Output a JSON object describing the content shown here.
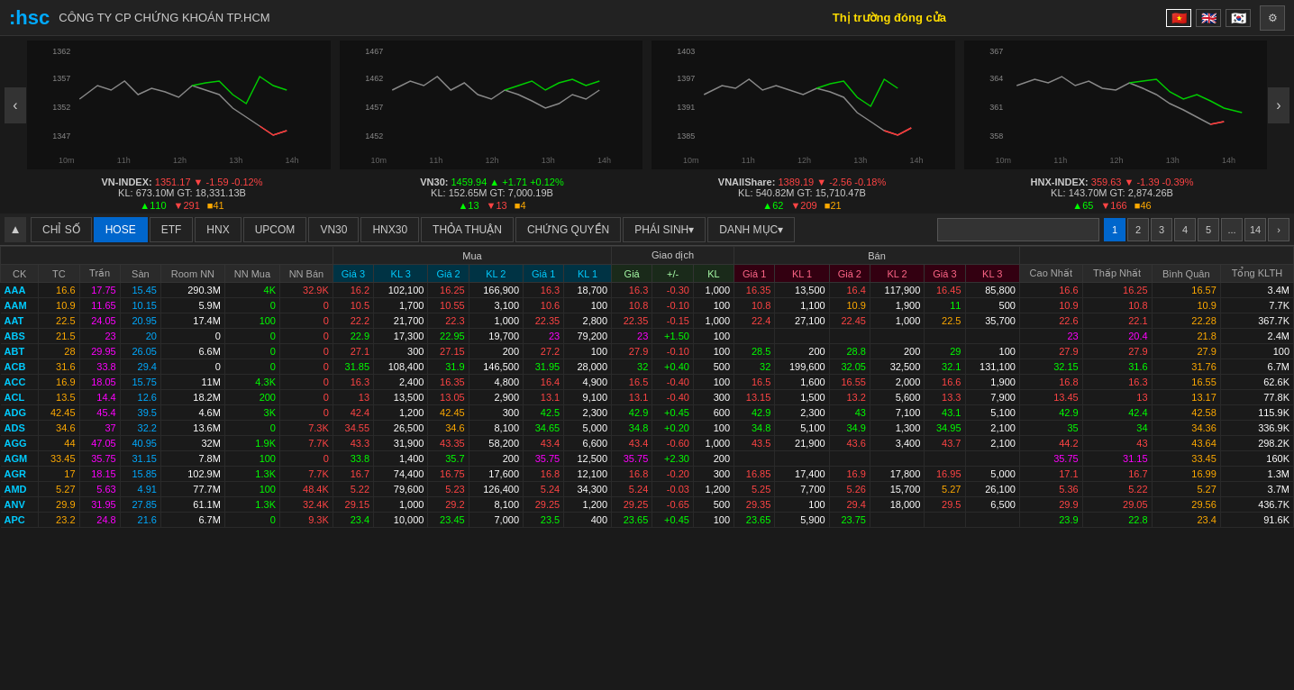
{
  "header": {
    "logo": ":hsc",
    "company": "CÔNG TY CP CHỨNG KHOÁN TP.HCM",
    "market_status": "Thị trường đóng cửa",
    "flags": [
      "🇻🇳",
      "🇬🇧",
      "🇰🇷"
    ],
    "gear_icon": "⚙"
  },
  "indices": [
    {
      "name": "VN-INDEX",
      "value": "1351.17",
      "arrow": "▼",
      "change": "-1.59",
      "pct": "-0.12%",
      "kl": "673.10M",
      "gt": "18,331.13B",
      "up": "110",
      "down": "291",
      "same": "41"
    },
    {
      "name": "VN30",
      "value": "1459.94",
      "arrow": "▲",
      "change": "+1.71",
      "pct": "+0.12%",
      "kl": "152.65M",
      "gt": "7,000.19B",
      "up": "13",
      "down": "13",
      "same": "4"
    },
    {
      "name": "VNAllShare",
      "value": "1389.19",
      "arrow": "▼",
      "change": "-2.56",
      "pct": "-0.18%",
      "kl": "540.82M",
      "gt": "15,710.47B",
      "up": "62",
      "down": "209",
      "same": "21"
    },
    {
      "name": "HNX-INDEX",
      "value": "359.63",
      "arrow": "▼",
      "change": "-1.39",
      "pct": "-0.39%",
      "kl": "143.70M",
      "gt": "2,874.26B",
      "up": "65",
      "down": "166",
      "same": "46"
    }
  ],
  "tabs": {
    "nav": [
      "CHỈ SỐ",
      "HOSE",
      "ETF",
      "HNX",
      "UPCOM",
      "VN30",
      "HNX30",
      "THỎA THUẬN",
      "CHỨNG QUYỀN",
      "PHÁI SINH",
      "DANH MỤC"
    ],
    "active": "HOSE",
    "pages": [
      "1",
      "2",
      "3",
      "4",
      "5",
      "...",
      "14"
    ],
    "active_page": "1",
    "next_icon": "›"
  },
  "table": {
    "headers": {
      "group1": [
        "CK",
        "TC",
        "Trần",
        "Sàn",
        "Room NN",
        "NN Mua",
        "NN Bán"
      ],
      "mua": "Mua",
      "mua_cols": [
        "Giá 3",
        "KL 3",
        "Giá 2",
        "KL 2",
        "Giá 1",
        "KL 1"
      ],
      "gd": "Giao dịch",
      "gd_cols": [
        "Giá",
        "+/-",
        "KL"
      ],
      "ban": "Bán",
      "ban_cols": [
        "Giá 1",
        "KL 1",
        "Giá 2",
        "KL 2",
        "Giá 3",
        "KL 3"
      ],
      "group2": [
        "Cao Nhất",
        "Thấp Nhất",
        "Bình Quân",
        "Tổng KLTH"
      ]
    },
    "rows": [
      {
        "ck": "AAA",
        "tc": "16.6",
        "tran": "17.75",
        "san": "15.45",
        "roomnn": "290.3M",
        "nn_mua": "4K",
        "nn_ban": "32.9K",
        "g3": "16.2",
        "kl3": "102,100",
        "g2": "16.25",
        "kl2": "166,900",
        "g1": "16.3",
        "kl1": "18,700",
        "gia": "16.3",
        "pm": "-0.30",
        "kl": "1,000",
        "b_g1": "16.35",
        "b_kl1": "13,500",
        "b_g2": "16.4",
        "b_kl2": "117,900",
        "b_g3": "16.45",
        "b_kl3": "85,800",
        "cao": "16.6",
        "thap": "16.25",
        "bq": "16.57",
        "tong": "3.4M",
        "tc_color": "ref",
        "gia_color": "down"
      },
      {
        "ck": "AAM",
        "tc": "10.9",
        "tran": "11.65",
        "san": "10.15",
        "roomnn": "5.9M",
        "nn_mua": "0",
        "nn_ban": "0",
        "g3": "10.5",
        "kl3": "1,700",
        "g2": "10.55",
        "kl2": "3,100",
        "g1": "10.6",
        "kl1": "100",
        "gia": "10.8",
        "pm": "-0.10",
        "kl": "100",
        "b_g1": "10.8",
        "b_kl1": "1,100",
        "b_g2": "10.9",
        "b_kl2": "1,900",
        "b_g3": "11",
        "b_kl3": "500",
        "cao": "10.9",
        "thap": "10.8",
        "bq": "10.9",
        "tong": "7.7K",
        "tc_color": "ref",
        "gia_color": "down"
      },
      {
        "ck": "AAT",
        "tc": "22.5",
        "tran": "24.05",
        "san": "20.95",
        "roomnn": "17.4M",
        "nn_mua": "100",
        "nn_ban": "0",
        "g3": "22.2",
        "kl3": "21,700",
        "g2": "22.3",
        "kl2": "1,000",
        "g1": "22.35",
        "kl1": "2,800",
        "gia": "22.35",
        "pm": "-0.15",
        "kl": "1,000",
        "b_g1": "22.4",
        "b_kl1": "27,100",
        "b_g2": "22.45",
        "b_kl2": "1,000",
        "b_g3": "22.5",
        "b_kl3": "35,700",
        "cao": "22.6",
        "thap": "22.1",
        "bq": "22.28",
        "tong": "367.7K",
        "tc_color": "ref",
        "gia_color": "down"
      },
      {
        "ck": "ABS",
        "tc": "21.5",
        "tran": "23",
        "san": "20",
        "roomnn": "0",
        "nn_mua": "0",
        "nn_ban": "0",
        "g3": "22.9",
        "kl3": "17,300",
        "g2": "22.95",
        "kl2": "19,700",
        "g1": "23",
        "kl1": "79,200",
        "gia": "23",
        "pm": "+1.50",
        "kl": "100",
        "b_g1": "",
        "b_kl1": "",
        "b_g2": "",
        "b_kl2": "",
        "b_g3": "",
        "b_kl3": "",
        "cao": "23",
        "thap": "20.4",
        "bq": "21.8",
        "tong": "2.4M",
        "tc_color": "ref",
        "gia_color": "ceil"
      },
      {
        "ck": "ABT",
        "tc": "28",
        "tran": "29.95",
        "san": "26.05",
        "roomnn": "6.6M",
        "nn_mua": "0",
        "nn_ban": "0",
        "g3": "27.1",
        "kl3": "300",
        "g2": "27.15",
        "kl2": "200",
        "g1": "27.2",
        "kl1": "100",
        "gia": "27.9",
        "pm": "-0.10",
        "kl": "100",
        "b_g1": "28.5",
        "b_kl1": "200",
        "b_g2": "28.8",
        "b_kl2": "200",
        "b_g3": "29",
        "b_kl3": "100",
        "cao": "27.9",
        "thap": "27.9",
        "bq": "27.9",
        "tong": "100",
        "tc_color": "ref",
        "gia_color": "down"
      },
      {
        "ck": "ACB",
        "tc": "31.6",
        "tran": "33.8",
        "san": "29.4",
        "roomnn": "0",
        "nn_mua": "0",
        "nn_ban": "0",
        "g3": "31.85",
        "kl3": "108,400",
        "g2": "31.9",
        "kl2": "146,500",
        "g1": "31.95",
        "kl1": "28,000",
        "gia": "32",
        "pm": "+0.40",
        "kl": "500",
        "b_g1": "32",
        "b_kl1": "199,600",
        "b_g2": "32.05",
        "b_kl2": "32,500",
        "b_g3": "32.1",
        "b_kl3": "131,100",
        "cao": "32.15",
        "thap": "31.6",
        "bq": "31.76",
        "tong": "6.7M",
        "tc_color": "ref",
        "gia_color": "up"
      },
      {
        "ck": "ACC",
        "tc": "16.9",
        "tran": "18.05",
        "san": "15.75",
        "roomnn": "11M",
        "nn_mua": "4.3K",
        "nn_ban": "0",
        "g3": "16.3",
        "kl3": "2,400",
        "g2": "16.35",
        "kl2": "4,800",
        "g1": "16.4",
        "kl1": "4,900",
        "gia": "16.5",
        "pm": "-0.40",
        "kl": "100",
        "b_g1": "16.5",
        "b_kl1": "1,600",
        "b_g2": "16.55",
        "b_kl2": "2,000",
        "b_g3": "16.6",
        "b_kl3": "1,900",
        "cao": "16.8",
        "thap": "16.3",
        "bq": "16.55",
        "tong": "62.6K",
        "tc_color": "ref",
        "gia_color": "down"
      },
      {
        "ck": "ACL",
        "tc": "13.5",
        "tran": "14.4",
        "san": "12.6",
        "roomnn": "18.2M",
        "nn_mua": "200",
        "nn_ban": "0",
        "g3": "13",
        "kl3": "13,500",
        "g2": "13.05",
        "kl2": "2,900",
        "g1": "13.1",
        "kl1": "9,100",
        "gia": "13.1",
        "pm": "-0.40",
        "kl": "300",
        "b_g1": "13.15",
        "b_kl1": "1,500",
        "b_g2": "13.2",
        "b_kl2": "5,600",
        "b_g3": "13.3",
        "b_kl3": "7,900",
        "cao": "13.45",
        "thap": "13",
        "bq": "13.17",
        "tong": "77.8K",
        "tc_color": "ref",
        "gia_color": "down"
      },
      {
        "ck": "ADG",
        "tc": "42.45",
        "tran": "45.4",
        "san": "39.5",
        "roomnn": "4.6M",
        "nn_mua": "3K",
        "nn_ban": "0",
        "g3": "42.4",
        "kl3": "1,200",
        "g2": "42.45",
        "kl2": "300",
        "g1": "42.5",
        "kl1": "2,300",
        "gia": "42.9",
        "pm": "+0.45",
        "kl": "600",
        "b_g1": "42.9",
        "b_kl1": "2,300",
        "b_g2": "43",
        "b_kl2": "7,100",
        "b_g3": "43.1",
        "b_kl3": "5,100",
        "cao": "42.9",
        "thap": "42.4",
        "bq": "42.58",
        "tong": "115.9K",
        "tc_color": "ref",
        "gia_color": "up"
      },
      {
        "ck": "ADS",
        "tc": "34.6",
        "tran": "37",
        "san": "32.2",
        "roomnn": "13.6M",
        "nn_mua": "0",
        "nn_ban": "7.3K",
        "g3": "34.55",
        "kl3": "26,500",
        "g2": "34.6",
        "kl2": "8,100",
        "g1": "34.65",
        "kl1": "5,000",
        "gia": "34.8",
        "pm": "+0.20",
        "kl": "100",
        "b_g1": "34.8",
        "b_kl1": "5,100",
        "b_g2": "34.9",
        "b_kl2": "1,300",
        "b_g3": "34.95",
        "b_kl3": "2,100",
        "cao": "35",
        "thap": "34",
        "bq": "34.36",
        "tong": "336.9K",
        "tc_color": "ref",
        "gia_color": "up"
      },
      {
        "ck": "AGG",
        "tc": "44",
        "tran": "47.05",
        "san": "40.95",
        "roomnn": "32M",
        "nn_mua": "1.9K",
        "nn_ban": "7.7K",
        "g3": "43.3",
        "kl3": "31,900",
        "g2": "43.35",
        "kl2": "58,200",
        "g1": "43.4",
        "kl1": "6,600",
        "gia": "43.4",
        "pm": "-0.60",
        "kl": "1,000",
        "b_g1": "43.5",
        "b_kl1": "21,900",
        "b_g2": "43.6",
        "b_kl2": "3,400",
        "b_g3": "43.7",
        "b_kl3": "2,100",
        "cao": "44.2",
        "thap": "43",
        "bq": "43.64",
        "tong": "298.2K",
        "tc_color": "ref",
        "gia_color": "down"
      },
      {
        "ck": "AGM",
        "tc": "33.45",
        "tran": "35.75",
        "san": "31.15",
        "roomnn": "7.8M",
        "nn_mua": "100",
        "nn_ban": "0",
        "g3": "33.8",
        "kl3": "1,400",
        "g2": "35.7",
        "kl2": "200",
        "g1": "35.75",
        "kl1": "12,500",
        "gia": "35.75",
        "pm": "+2.30",
        "kl": "200",
        "b_g1": "",
        "b_kl1": "",
        "b_g2": "",
        "b_kl2": "",
        "b_g3": "",
        "b_kl3": "",
        "cao": "35.75",
        "thap": "31.15",
        "bq": "33.45",
        "tong": "160K",
        "tc_color": "ref",
        "gia_color": "ceil"
      },
      {
        "ck": "AGR",
        "tc": "17",
        "tran": "18.15",
        "san": "15.85",
        "roomnn": "102.9M",
        "nn_mua": "1.3K",
        "nn_ban": "7.7K",
        "g3": "16.7",
        "kl3": "74,400",
        "g2": "16.75",
        "kl2": "17,600",
        "g1": "16.8",
        "kl1": "12,100",
        "gia": "16.8",
        "pm": "-0.20",
        "kl": "300",
        "b_g1": "16.85",
        "b_kl1": "17,400",
        "b_g2": "16.9",
        "b_kl2": "17,800",
        "b_g3": "16.95",
        "b_kl3": "5,000",
        "cao": "17.1",
        "thap": "16.7",
        "bq": "16.99",
        "tong": "1.3M",
        "tc_color": "ref",
        "gia_color": "down"
      },
      {
        "ck": "AMD",
        "tc": "5.27",
        "tran": "5.63",
        "san": "4.91",
        "roomnn": "77.7M",
        "nn_mua": "100",
        "nn_ban": "48.4K",
        "g3": "5.22",
        "kl3": "79,600",
        "g2": "5.23",
        "kl2": "126,400",
        "g1": "5.24",
        "kl1": "34,300",
        "gia": "5.24",
        "pm": "-0.03",
        "kl": "1,200",
        "b_g1": "5.25",
        "b_kl1": "7,700",
        "b_g2": "5.26",
        "b_kl2": "15,700",
        "b_g3": "5.27",
        "b_kl3": "26,100",
        "cao": "5.36",
        "thap": "5.22",
        "bq": "5.27",
        "tong": "3.7M",
        "tc_color": "ref",
        "gia_color": "down"
      },
      {
        "ck": "ANV",
        "tc": "29.9",
        "tran": "31.95",
        "san": "27.85",
        "roomnn": "61.1M",
        "nn_mua": "1.3K",
        "nn_ban": "32.4K",
        "g3": "29.15",
        "kl3": "1,000",
        "g2": "29.2",
        "kl2": "8,100",
        "g1": "29.25",
        "kl1": "1,200",
        "gia": "29.25",
        "pm": "-0.65",
        "kl": "500",
        "b_g1": "29.35",
        "b_kl1": "100",
        "b_g2": "29.4",
        "b_kl2": "18,000",
        "b_g3": "29.5",
        "b_kl3": "6,500",
        "cao": "29.9",
        "thap": "29.05",
        "bq": "29.56",
        "tong": "436.7K",
        "tc_color": "ref",
        "gia_color": "down"
      },
      {
        "ck": "APC",
        "tc": "23.2",
        "tran": "24.8",
        "san": "21.6",
        "roomnn": "6.7M",
        "nn_mua": "0",
        "nn_ban": "9.3K",
        "g3": "23.4",
        "kl3": "10,000",
        "g2": "23.45",
        "kl2": "7,000",
        "g1": "23.5",
        "kl1": "400",
        "gia": "23.65",
        "pm": "+0.45",
        "kl": "100",
        "b_g1": "23.65",
        "b_kl1": "5,900",
        "b_g2": "23.75",
        "b_kl2": "",
        "b_g3": "",
        "b_kl3": "",
        "cao": "23.9",
        "thap": "22.8",
        "bq": "23.4",
        "tong": "91.6K",
        "tc_color": "ref",
        "gia_color": "up"
      }
    ]
  }
}
